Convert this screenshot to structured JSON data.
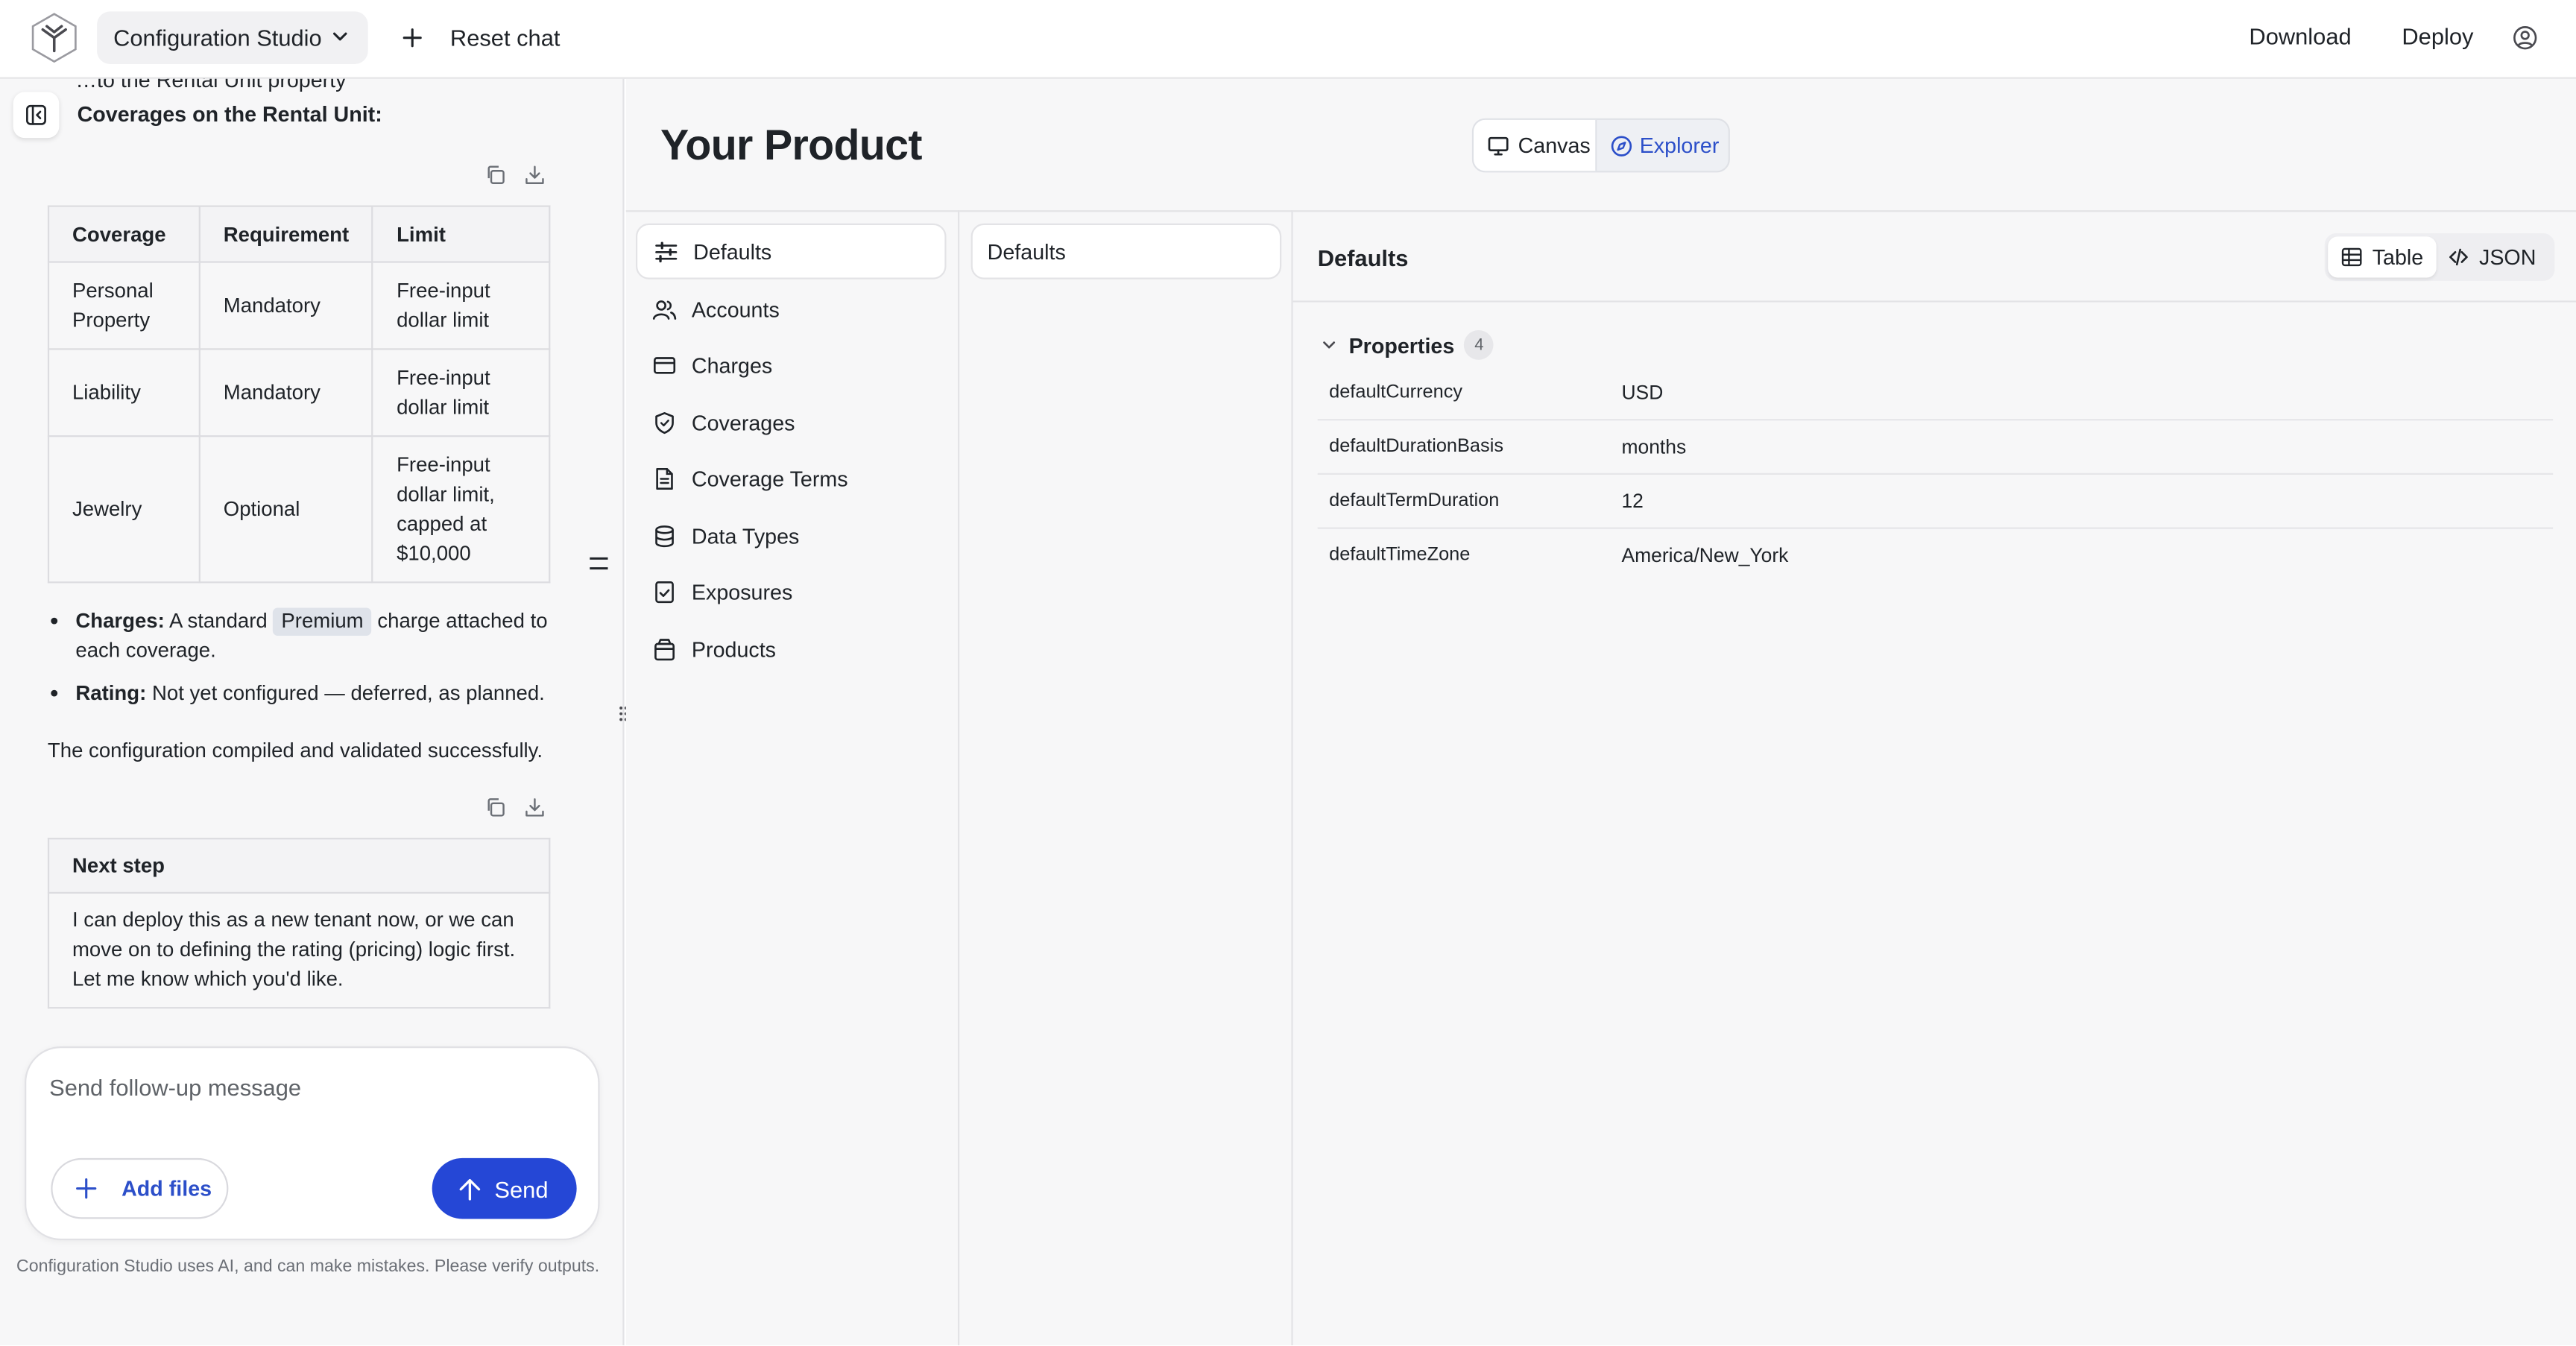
{
  "header": {
    "project_name": "Configuration Studio",
    "reset_label": "Reset chat",
    "download_label": "Download",
    "deploy_label": "Deploy"
  },
  "chat": {
    "cut_off_text": "…to the Rental Unit property",
    "coverages_heading": "Coverages on the Rental Unit:",
    "coverage_table": {
      "headers": [
        "Coverage",
        "Requirement",
        "Limit"
      ],
      "rows": [
        [
          "Personal Property",
          "Mandatory",
          "Free-input dollar limit"
        ],
        [
          "Liability",
          "Mandatory",
          "Free-input dollar limit"
        ],
        [
          "Jewelry",
          "Optional",
          "Free-input dollar limit, capped at $10,000"
        ]
      ]
    },
    "bullets": [
      {
        "label": "Charges:",
        "pre": "A standard",
        "chip": "Premium",
        "post": "charge attached to each coverage."
      },
      {
        "label": "Rating:",
        "text": "Not yet configured — deferred, as planned."
      }
    ],
    "confirmation": "The configuration compiled and validated successfully.",
    "next_table": {
      "header": "Next step",
      "body": "I can deploy this as a new tenant now, or we can move on to defining the rating (pricing) logic first. Let me know which you'd like."
    },
    "composer": {
      "placeholder": "Send follow-up message",
      "add_files_label": "Add files",
      "send_label": "Send"
    },
    "disclaimer": "Configuration Studio uses AI, and can make mistakes. Please verify outputs."
  },
  "main": {
    "title": "Your Product",
    "view_toggle": {
      "canvas": "Canvas",
      "explorer": "Explorer",
      "selected": "Explorer"
    },
    "nav": [
      {
        "label": "Defaults",
        "icon": "sliders-icon",
        "active": true
      },
      {
        "label": "Accounts",
        "icon": "users-icon"
      },
      {
        "label": "Charges",
        "icon": "credit-card-icon"
      },
      {
        "label": "Coverages",
        "icon": "shield-icon"
      },
      {
        "label": "Coverage Terms",
        "icon": "document-icon"
      },
      {
        "label": "Data Types",
        "icon": "database-icon"
      },
      {
        "label": "Exposures",
        "icon": "checklist-icon"
      },
      {
        "label": "Products",
        "icon": "package-icon"
      }
    ],
    "subnav": [
      "Defaults"
    ],
    "detail": {
      "title": "Defaults",
      "format_toggle": {
        "table": "Table",
        "json": "JSON",
        "selected": "Table"
      },
      "properties_label": "Properties",
      "properties_count": "4",
      "properties": [
        {
          "key": "defaultCurrency",
          "value": "USD"
        },
        {
          "key": "defaultDurationBasis",
          "value": "months"
        },
        {
          "key": "defaultTermDuration",
          "value": "12"
        },
        {
          "key": "defaultTimeZone",
          "value": "America/New_York"
        }
      ]
    }
  },
  "colors": {
    "accent": "#2547d6",
    "accent_text": "#2c4fc9",
    "panel_bg": "#f7f7f8",
    "border": "#e3e3e6"
  }
}
